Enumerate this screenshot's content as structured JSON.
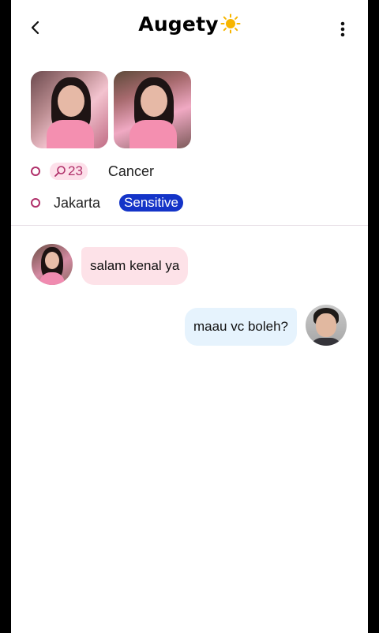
{
  "header": {
    "title": "Augety",
    "back_icon": "chevron-left-icon",
    "title_emoji": "sun-icon",
    "more_icon": "more-vertical-icon"
  },
  "profile": {
    "age": "23",
    "age_icon": "search-icon",
    "zodiac": "Cancer",
    "city": "Jakarta",
    "tag": "Sensitive",
    "accent_color": "#b0306a",
    "tag_color": "#1434c8"
  },
  "messages": [
    {
      "from": "them",
      "text": "salam kenal ya"
    },
    {
      "from": "me",
      "text": "maau vc boleh?"
    }
  ]
}
